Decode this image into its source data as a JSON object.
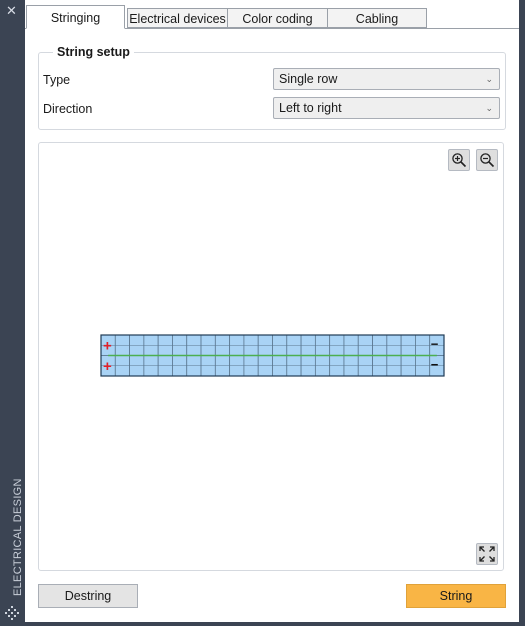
{
  "sidebar": {
    "close_glyph": "✕",
    "vertical_label": "ELECTRICAL DESIGN",
    "grip_icon": "drag-grip-icon"
  },
  "tabs": [
    {
      "label": "Stringing",
      "active": true
    },
    {
      "label": "Electrical devices",
      "active": false
    },
    {
      "label": "Color coding",
      "active": false
    },
    {
      "label": "Cabling",
      "active": false
    }
  ],
  "string_setup": {
    "title": "String setup",
    "type_label": "Type",
    "type_value": "Single row",
    "direction_label": "Direction",
    "direction_value": "Left to right"
  },
  "canvas": {
    "zoom_in_icon": "zoom-in-icon",
    "zoom_out_icon": "zoom-out-icon",
    "fit_icon": "fit-to-screen-icon",
    "array": {
      "columns": 24,
      "rows": 2,
      "positive_symbol": "+",
      "negative_symbol": "−",
      "panel_color": "#a9d3f5",
      "string_line_color": "#4caf50",
      "positive_color": "#e0202a"
    }
  },
  "actions": {
    "destring_label": "Destring",
    "string_label": "String",
    "accent_color": "#f9b545"
  }
}
